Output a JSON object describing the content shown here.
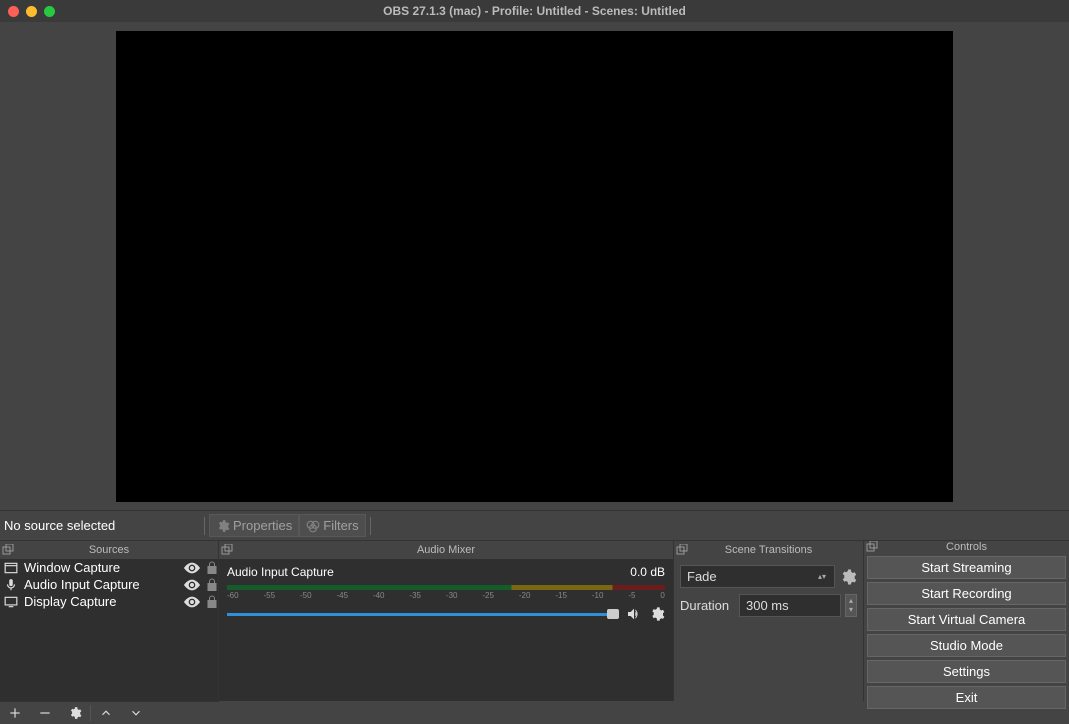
{
  "window": {
    "title": "OBS 27.1.3 (mac) - Profile: Untitled - Scenes: Untitled"
  },
  "status_bar": {
    "no_source": "No source selected",
    "properties": "Properties",
    "filters": "Filters"
  },
  "docks": {
    "sources_title": "Sources",
    "mixer_title": "Audio Mixer",
    "transitions_title": "Scene Transitions",
    "controls_title": "Controls"
  },
  "sources": [
    {
      "icon": "window",
      "label": "Window Capture"
    },
    {
      "icon": "mic",
      "label": "Audio Input Capture"
    },
    {
      "icon": "display",
      "label": "Display Capture"
    }
  ],
  "mixer": {
    "track_name": "Audio Input Capture",
    "db_value": "0.0 dB",
    "ticks": [
      "-60",
      "-55",
      "-50",
      "-45",
      "-40",
      "-35",
      "-30",
      "-25",
      "-20",
      "-15",
      "-10",
      "-5",
      "0"
    ]
  },
  "transitions": {
    "selected": "Fade",
    "duration_label": "Duration",
    "duration_value": "300 ms"
  },
  "controls": {
    "start_streaming": "Start Streaming",
    "start_recording": "Start Recording",
    "start_vcam": "Start Virtual Camera",
    "studio_mode": "Studio Mode",
    "settings": "Settings",
    "exit": "Exit"
  }
}
